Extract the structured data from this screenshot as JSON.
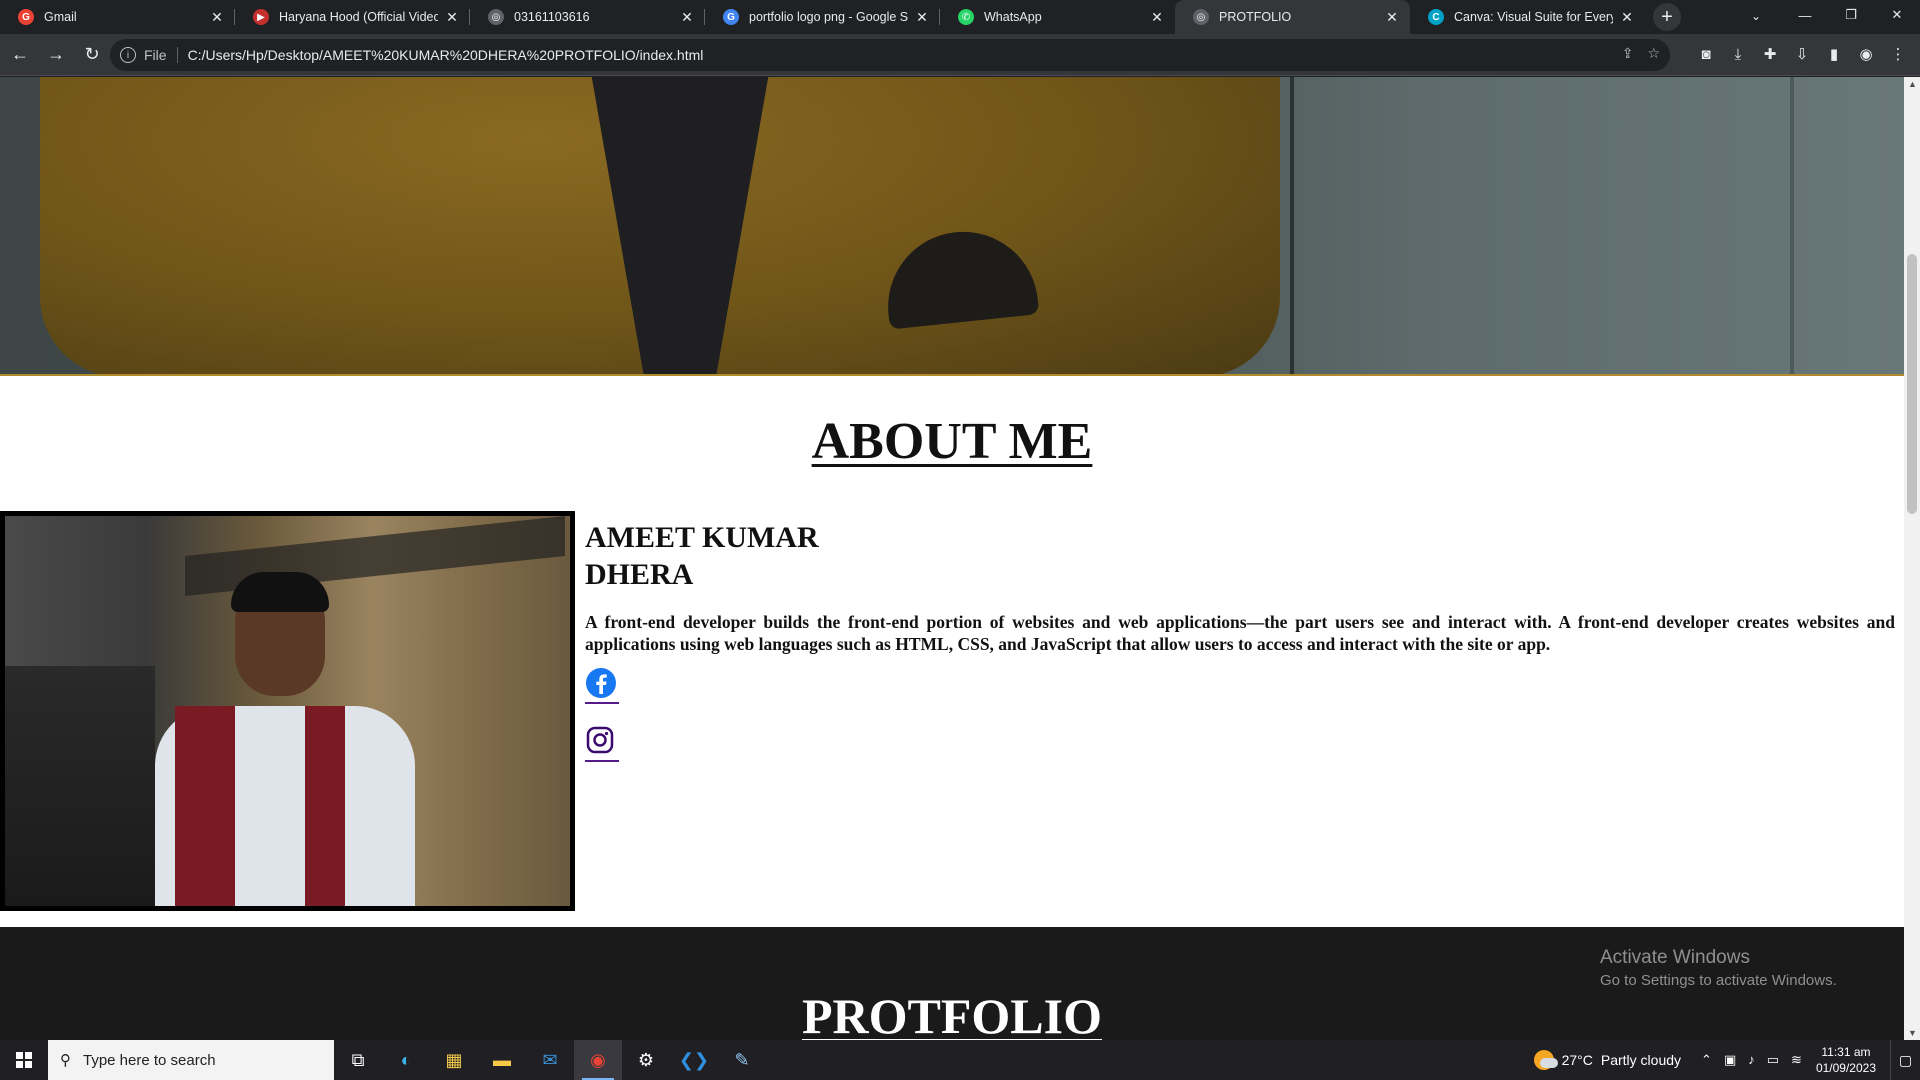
{
  "browser": {
    "tabs": [
      {
        "title": "Gmail",
        "favicon": "google-icon",
        "color": "#ea4335",
        "active": false
      },
      {
        "title": "Haryana Hood (Official Video) ||",
        "favicon": "youtube-icon",
        "color": "#c4302b",
        "active": false
      },
      {
        "title": "03161103616",
        "favicon": "globe-icon",
        "color": "#9aa0a6",
        "active": false
      },
      {
        "title": "portfolio logo png - Google Sea",
        "favicon": "google-icon",
        "color": "#4285f4",
        "active": false
      },
      {
        "title": "WhatsApp",
        "favicon": "whatsapp-icon",
        "color": "#25d366",
        "active": false
      },
      {
        "title": "PROTFOLIO",
        "favicon": "globe-icon",
        "color": "#9aa0a6",
        "active": true
      },
      {
        "title": "Canva: Visual Suite for Everyone",
        "favicon": "canva-icon",
        "color": "#00c4cc",
        "active": false
      }
    ],
    "new_tab_label": "+",
    "address": {
      "scheme_label": "File",
      "url": "C:/Users/Hp/Desktop/AMEET%20KUMAR%20DHERA%20PROTFOLIO/index.html"
    }
  },
  "page": {
    "about": {
      "title": "ABOUT ME",
      "name_line1": "AMEET KUMAR",
      "name_line2": "DHERA",
      "bio": "A front-end developer builds the front-end portion of websites and web applications—the part users see and interact with. A front-end developer creates websites and applications using web languages such as HTML, CSS, and JavaScript that allow users to access and interact with the site or app.",
      "social": [
        {
          "name": "facebook-icon",
          "color": "#1877f2"
        },
        {
          "name": "instagram-icon",
          "color": "#3b0a6e"
        }
      ]
    },
    "portfolio": {
      "title": "PROTFOLIO"
    },
    "watermark": {
      "line1": "Activate Windows",
      "line2": "Go to Settings to activate Windows."
    }
  },
  "taskbar": {
    "search_placeholder": "Type here to search",
    "apps": [
      {
        "name": "task-view-icon",
        "active": false
      },
      {
        "name": "edge-icon",
        "active": false
      },
      {
        "name": "store-icon",
        "active": false
      },
      {
        "name": "file-explorer-icon",
        "active": false
      },
      {
        "name": "mail-icon",
        "active": false
      },
      {
        "name": "chrome-icon",
        "active": true
      },
      {
        "name": "settings-icon",
        "active": false
      },
      {
        "name": "vscode-icon",
        "active": false
      },
      {
        "name": "notepad-icon",
        "active": false
      }
    ],
    "weather": {
      "temp": "27°C",
      "condition": "Partly cloudy"
    },
    "time": "11:31 am",
    "date": "01/09/2023"
  }
}
